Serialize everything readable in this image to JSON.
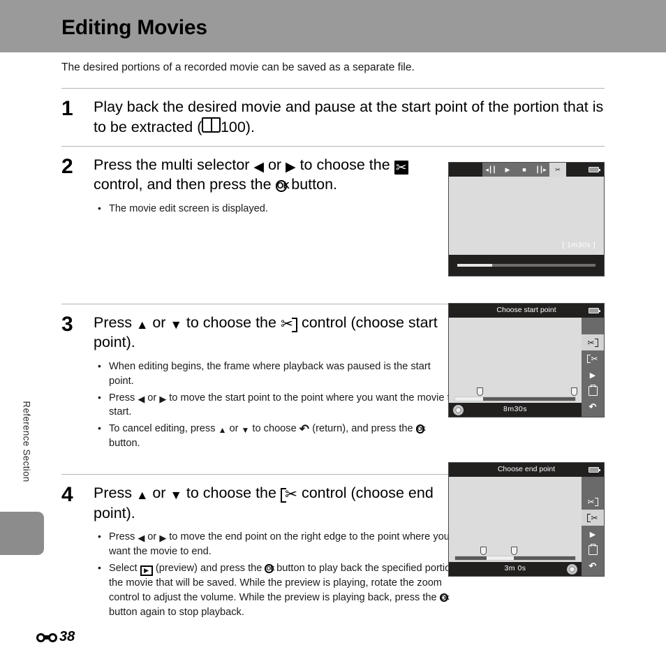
{
  "header": {
    "title": "Editing Movies"
  },
  "side": {
    "section_label": "Reference Section"
  },
  "intro": "The desired portions of a recorded movie can be saved as a separate file.",
  "steps": [
    {
      "num": "1",
      "head_a": "Play back the desired movie and pause at the start point of the portion that is to be extracted (",
      "head_b": "100).",
      "bullets": []
    },
    {
      "num": "2",
      "head_a": "Press the multi selector ",
      "head_or": " or ",
      "head_b": " to choose the ",
      "head_c": " control, and then press the ",
      "head_d": " button.",
      "bullets": [
        "The movie edit screen is displayed."
      ]
    },
    {
      "num": "3",
      "head_a": "Press ",
      "head_or": " or ",
      "head_b": " to choose the ",
      "head_c": " control (choose start point).",
      "bullets": [
        "When editing begins, the frame where playback was paused is the start point.",
        "Press ◀ or ▶ to move the start point to the point where you want the movie to start.",
        "To cancel editing, press ▲ or ▼ to choose ↶ (return), and press the OK button."
      ]
    },
    {
      "num": "4",
      "head_a": "Press ",
      "head_or": " or ",
      "head_b": " to choose the ",
      "head_c": " control (choose end point).",
      "bullets": [
        "Press ◀ or ▶ to move the end point on the right edge to the point where you want the movie to end.",
        "Select ▶ (preview) and press the OK button to play back the specified portion of the movie that will be saved. While the preview is playing, rotate the zoom control to adjust the volume. While the preview is playing back, press the OK button again to stop playback."
      ]
    }
  ],
  "step3_bullets": {
    "b1": "When editing begins, the frame where playback was paused is the start point.",
    "b2_a": "Press ",
    "b2_or": " or ",
    "b2_b": " to move the start point to the point where you want the movie to start.",
    "b3_a": "To cancel editing, press ",
    "b3_or": " or ",
    "b3_b": " to choose ",
    "b3_c": " (return), and press the ",
    "b3_d": " button."
  },
  "step4_bullets": {
    "b1_a": "Press ",
    "b1_or": " or ",
    "b1_b": " to move the end point on the right edge to the point where you want the movie to end.",
    "b2_a": "Select ",
    "b2_b": " (preview) and press the ",
    "b2_c": " button to play back the specified portion of the movie that will be saved. While the preview is playing, rotate the zoom control to adjust the volume. While the preview is playing back, press the ",
    "b2_d": " button again to stop playback."
  },
  "screens": {
    "playback": {
      "controls": [
        "rewind-icon",
        "play-icon",
        "stop-icon",
        "advance-icon",
        "scissors-icon"
      ],
      "selected_control_index": 4,
      "time": "[    1m30s ]",
      "progress_percent": 25,
      "battery": "battery-icon"
    },
    "start_point": {
      "title": "Choose start point",
      "time": "8m30s",
      "marker_start_percent": 23,
      "marker_end_percent": 94,
      "fill_percent": 23,
      "sidebar_icons": [
        "scissors-start-icon",
        "scissors-end-icon",
        "play-icon",
        "save-icon",
        "return-icon"
      ],
      "selected_sidebar_index": 0,
      "multiselector_position": "left",
      "battery": "battery-icon"
    },
    "end_point": {
      "title": "Choose end point",
      "time": "3m 0s",
      "marker_start_percent": 26,
      "marker_end_percent": 49,
      "fill_start_percent": 26,
      "fill_end_percent": 49,
      "sidebar_icons": [
        "scissors-start-icon",
        "scissors-end-icon",
        "play-icon",
        "save-icon",
        "return-icon"
      ],
      "selected_sidebar_index": 1,
      "multiselector_position": "right",
      "battery": "battery-icon"
    }
  },
  "footer": {
    "page_prefix_icon": "reference-section-icon",
    "page_number": "38"
  },
  "colors": {
    "header_band": "#9a9a9a",
    "screen_bezel": "#221f1f",
    "screen_view": "#dcdcdc",
    "sidebar_bg": "#6a6a6a",
    "selected_highlight": "#d4d4d4"
  }
}
